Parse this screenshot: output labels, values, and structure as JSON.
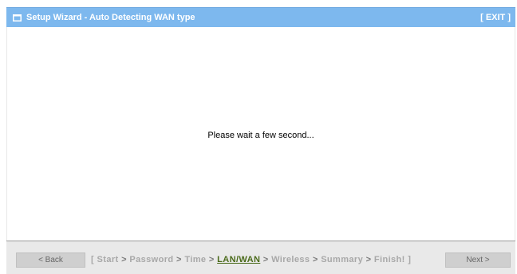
{
  "window": {
    "title": "Setup Wizard - Auto Detecting WAN type",
    "exit_label": "[ EXIT ]",
    "icon": "window-icon"
  },
  "content": {
    "message": "Please wait a few second..."
  },
  "footer": {
    "back_label": "< Back",
    "next_label": "Next >",
    "open_bracket": "[",
    "close_bracket": "]",
    "steps": [
      {
        "label": "Start"
      },
      {
        "label": "Password"
      },
      {
        "label": "Time"
      },
      {
        "label": "LAN/WAN",
        "current": true
      },
      {
        "label": "Wireless"
      },
      {
        "label": "Summary"
      },
      {
        "label": "Finish!"
      }
    ],
    "separator": ">"
  },
  "colors": {
    "titlebar": "#7db8ee",
    "active_step": "#4a6a1a",
    "inactive_step": "#a8a8a8",
    "footer_bg": "#e9e9e9"
  }
}
